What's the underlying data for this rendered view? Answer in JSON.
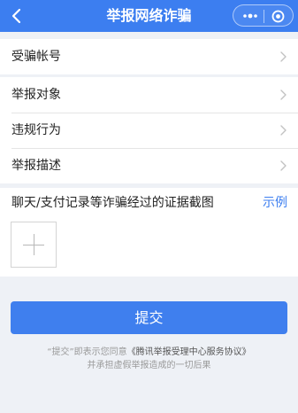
{
  "header": {
    "title": "举报网络诈骗",
    "back_icon": "chevron-left-icon",
    "more_icon": "more-dots-icon",
    "close_icon": "target-circle-icon",
    "background": "#3c7ef0"
  },
  "group1": {
    "items": [
      {
        "label": "受骗帐号"
      }
    ]
  },
  "group2": {
    "items": [
      {
        "label": "举报对象"
      },
      {
        "label": "违规行为"
      },
      {
        "label": "举报描述"
      }
    ]
  },
  "evidence": {
    "label": "聊天/支付记录等诈骗经过的证据截图",
    "example_link": "示例",
    "upload_icon": "plus-icon"
  },
  "submit": {
    "label": "提交",
    "color": "#3f7fee"
  },
  "footer": {
    "prefix": "“提交”即表示您同意",
    "agreement_link": "《腾讯举报受理中心服务协议》",
    "line2": "并承担虚假举报造成的一切后果"
  }
}
